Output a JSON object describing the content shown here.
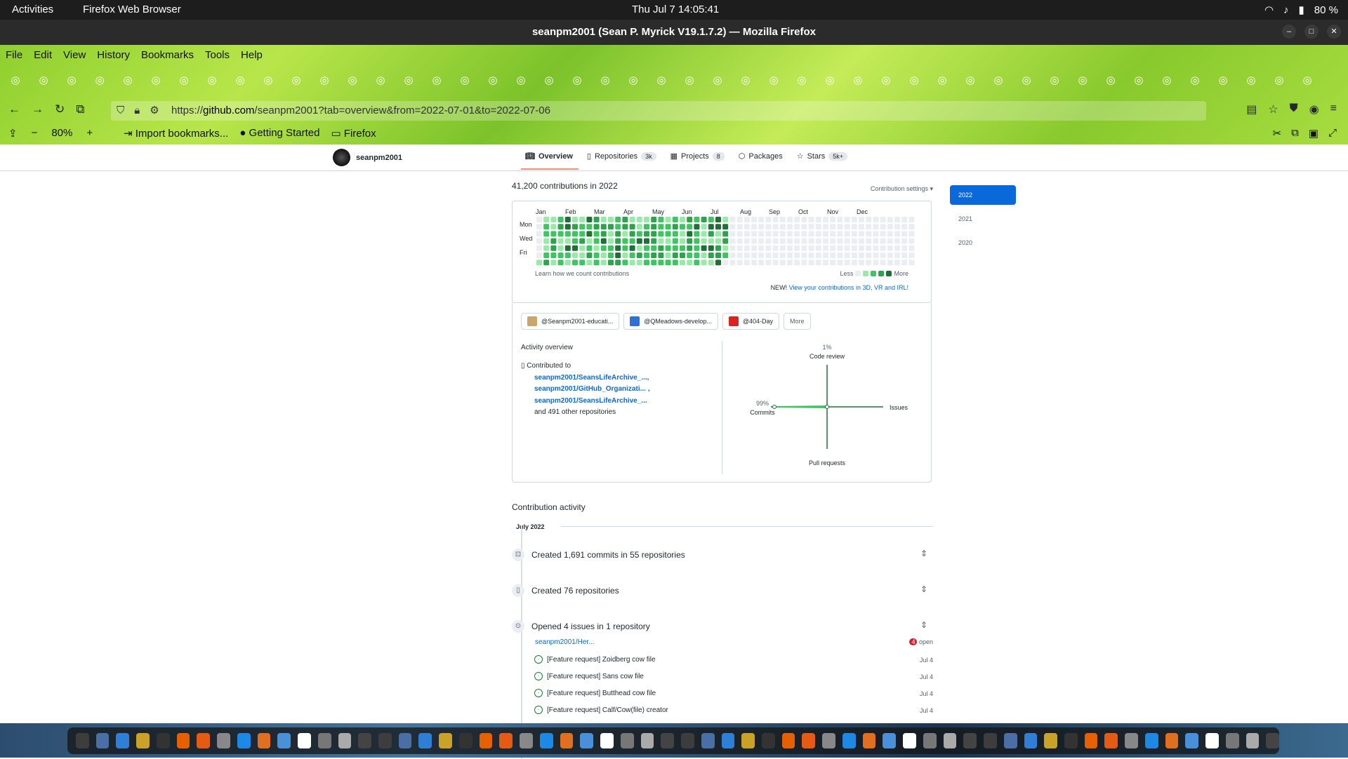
{
  "topbar": {
    "activities": "Activities",
    "app": "Firefox Web Browser",
    "clock": "Thu Jul 7  14:05:41",
    "battery": "80 %"
  },
  "titlebar": {
    "title": "seanpm2001 (Sean P. Myrick V19.1.7.2) — Mozilla Firefox"
  },
  "menu": [
    "File",
    "Edit",
    "View",
    "History",
    "Bookmarks",
    "Tools",
    "Help"
  ],
  "url": {
    "scheme": "https://",
    "host": "github.com",
    "path": "/seanpm2001?tab=overview&from=2022-07-01&to=2022-07-06"
  },
  "zoom": "80%",
  "bookmarks": {
    "import": "Import bookmarks...",
    "getting_started": "Getting Started",
    "firefox": "Firefox"
  },
  "github": {
    "username": "seanpm2001",
    "tabs": [
      {
        "label": "Overview",
        "count": ""
      },
      {
        "label": "Repositories",
        "count": "3k"
      },
      {
        "label": "Projects",
        "count": "8"
      },
      {
        "label": "Packages",
        "count": ""
      },
      {
        "label": "Stars",
        "count": "5k+"
      }
    ],
    "contrib_heading": "41,200 contributions in 2022",
    "contrib_settings": "Contribution settings ▾",
    "months": [
      "Jan",
      "Feb",
      "Mar",
      "Apr",
      "May",
      "Jun",
      "Jul",
      "Aug",
      "Sep",
      "Oct",
      "Nov",
      "Dec"
    ],
    "days": [
      "Mon",
      "Wed",
      "Fri"
    ],
    "learn": "Learn how we count contributions",
    "less": "Less",
    "more": "More",
    "new_label": "NEW!",
    "new_link": "View your contributions in 3D, VR and IRL!",
    "orgs": [
      "@Seanpm2001-educati...",
      "@QMeadows-develop...",
      "@404-Day",
      "More"
    ],
    "activity_overview": "Activity overview",
    "contributed_to": "Contributed to",
    "repos": [
      "seanpm2001/SeansLifeArchive_...,",
      "seanpm2001/GitHub_Organizati... ,",
      "seanpm2001/SeansLifeArchive_..."
    ],
    "other_repos": "and 491 other repositories",
    "radar": {
      "code_review_pct": "1%",
      "code_review": "Code review",
      "commits_pct": "99%",
      "commits": "Commits",
      "issues": "Issues",
      "pull_requests": "Pull requests"
    },
    "activity_title": "Contribution activity",
    "month": "July 2022",
    "events": [
      "Created 1,691 commits in 55 repositories",
      "Created 76 repositories",
      "Opened 4 issues in 1 repository"
    ],
    "issue_repo": "seanpm2001/Her...",
    "issue_badge": "4",
    "issue_state": "open",
    "issues": [
      {
        "title": "[Feature request] Zoidberg cow file",
        "date": "Jul 4"
      },
      {
        "title": "[Feature request] Sans cow file",
        "date": "Jul 4"
      },
      {
        "title": "[Feature request] Butthead cow file",
        "date": "Jul 4"
      },
      {
        "title": "[Feature request] Calf/Cow(file) creator",
        "date": "Jul 4"
      }
    ],
    "years": [
      "2022",
      "2021",
      "2020"
    ]
  },
  "colors": {
    "accent": "#0969da",
    "green1": "#9be9a8",
    "green2": "#40c463",
    "green3": "#30a14e",
    "green4": "#216e39"
  }
}
